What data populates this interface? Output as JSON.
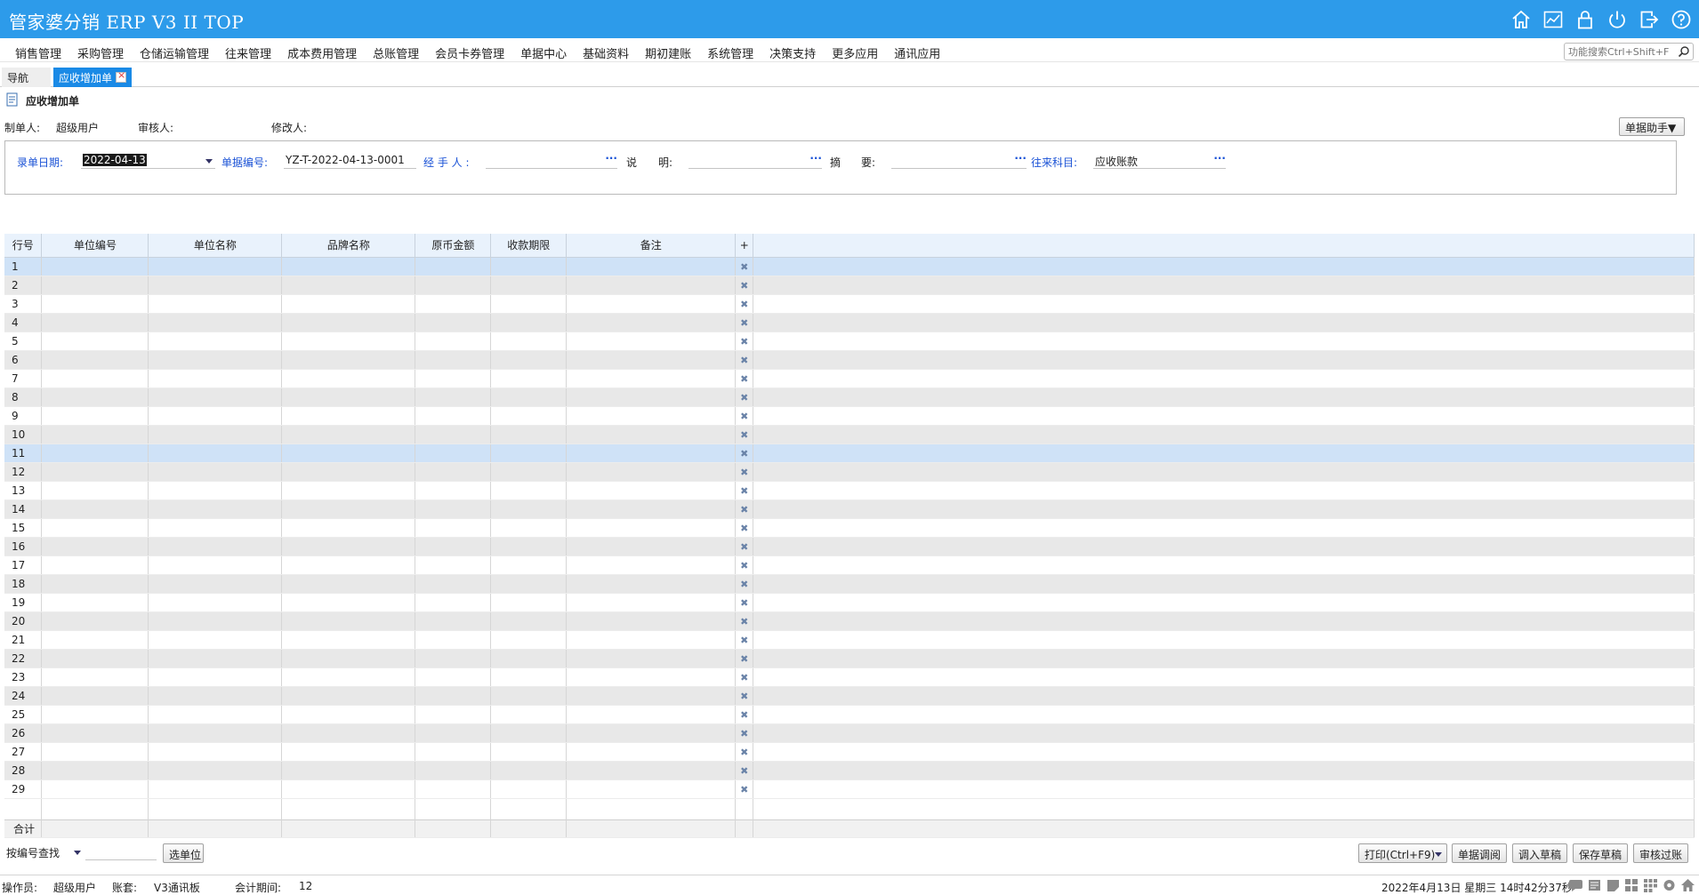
{
  "app": {
    "title": "管家婆分销 ERP V3 II TOP"
  },
  "titlebar_icons": [
    "home-icon",
    "chart-icon",
    "lock-icon",
    "power-icon",
    "exit-icon",
    "help-icon"
  ],
  "menu": [
    "销售管理",
    "采购管理",
    "仓储运输管理",
    "往来管理",
    "成本费用管理",
    "总账管理",
    "会员卡券管理",
    "单据中心",
    "基础资料",
    "期初建账",
    "系统管理",
    "决策支持",
    "更多应用",
    "通讯应用"
  ],
  "search": {
    "placeholder": "功能搜索Ctrl+Shift+F"
  },
  "tabs": {
    "nav": "导航",
    "current": "应收增加单"
  },
  "document": {
    "title": "应收增加单"
  },
  "meta": {
    "creator_label": "制单人:",
    "creator": "超级用户",
    "auditor_label": "审核人:",
    "modifier_label": "修改人:"
  },
  "helper_button": "单据助手▼",
  "form": {
    "date_label": "录单日期:",
    "date_value": "2022-04-13",
    "number_label": "单据编号:",
    "number_value": "YZ-T-2022-04-13-0001",
    "handler_label": "经 手 人 :",
    "desc_label1": "说",
    "desc_label2": "明:",
    "summary_label1": "摘",
    "summary_label2": "要:",
    "account_label": "往来科目:",
    "account_value": "应收账款",
    "ellipsis": "···"
  },
  "grid": {
    "columns": [
      "行号",
      "单位编号",
      "单位名称",
      "品牌名称",
      "原币金额",
      "收款期限",
      "备注",
      "+"
    ],
    "rows": [
      "1",
      "2",
      "3",
      "4",
      "5",
      "6",
      "7",
      "8",
      "9",
      "10",
      "11",
      "12",
      "13",
      "14",
      "15",
      "16",
      "17",
      "18",
      "19",
      "20",
      "21",
      "22",
      "23",
      "24",
      "25",
      "26",
      "27",
      "28",
      "29"
    ],
    "selected_rows": [
      1,
      11
    ],
    "delete_icon": "✖",
    "sum_label": "合计"
  },
  "bottom": {
    "find_mode": "按编号查找",
    "select_unit": "选单位",
    "print": "打印(Ctrl+F9)",
    "lookup": "单据调阅",
    "load_draft": "调入草稿",
    "save_draft": "保存草稿",
    "audit": "审核过账"
  },
  "status": {
    "operator_label": "操作员:",
    "operator": "超级用户",
    "account_label": "账套:",
    "account": "V3通讯板",
    "period_label": "会计期间:",
    "period": "12",
    "datetime": "2022年4月13日 星期三 14时42分37秒"
  },
  "colors": {
    "titlebar": "#2d9bea",
    "active_tab": "#1a8ae6",
    "label_blue": "#1a52d6",
    "selected_row": "#cfe2f7"
  }
}
